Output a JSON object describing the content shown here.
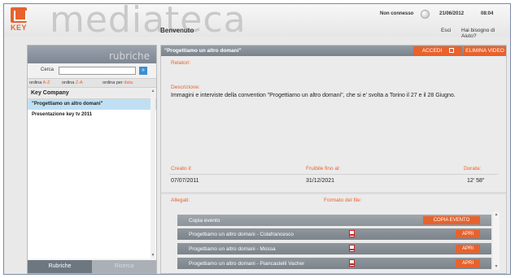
{
  "header": {
    "logo_text": "KEY",
    "brand": "mediateca",
    "welcome": "Benvenuto",
    "connection_status": "Non connesso",
    "date": "21/06/2012",
    "time": "08:04",
    "exit_label": "Esci",
    "help_label": "Hai bisogno di Aiuto?"
  },
  "sidebar": {
    "title": "rubriche",
    "search_label": "Cerca",
    "search_value": "",
    "search_button": "»",
    "sort": [
      {
        "prefix": "ordina ",
        "accent": "A-Z"
      },
      {
        "prefix": "ordina ",
        "accent": "Z-A"
      },
      {
        "prefix": "ordina per ",
        "accent": "data"
      }
    ],
    "group_header": "Key Company",
    "items": [
      {
        "label": "\"Progettiamo un altro domani\"",
        "selected": true
      },
      {
        "label": "Presentazione key tv 2011",
        "selected": false
      }
    ],
    "tabs": {
      "active": "Rubriche",
      "inactive": "Ricerca"
    }
  },
  "main": {
    "title": "\"Progettiamo un altro domani\"",
    "accedi_label": "ACCEDI",
    "elimina_label": "ELIMINA VIDEO",
    "relatori_label": "Relatori:",
    "descrizione_label": "Descrizione:",
    "descrizione": "Immagini e interviste della convention \"Progettiamo un altro domani\", che si e' svolta a Torino il 27 e il 28 Giugno.",
    "creato_label": "Creato il:",
    "creato_value": "07/07/2011",
    "fruibile_label": "Fruibile fino al:",
    "fruibile_value": "31/12/2021",
    "durata_label": "Durata:",
    "durata_value": "12' 58\"",
    "allegati_label": "Allegati:",
    "formato_label": "Formato del file:",
    "files": [
      {
        "name": "Copia evento",
        "button": "COPIA EVENTO",
        "pdf": false
      },
      {
        "name": "Progettiamo un altro domani - Colafrancesco",
        "button": "APRI",
        "pdf": true
      },
      {
        "name": "Progettiamo un altro domani - Mossa",
        "button": "APRI",
        "pdf": true
      },
      {
        "name": "Progettiamo un altro domani - Piancastelli Vacher",
        "button": "APRI",
        "pdf": true
      }
    ]
  },
  "colors": {
    "accent": "#e8622c",
    "selection": "#bfe0f3",
    "bar": "#7a838c"
  }
}
